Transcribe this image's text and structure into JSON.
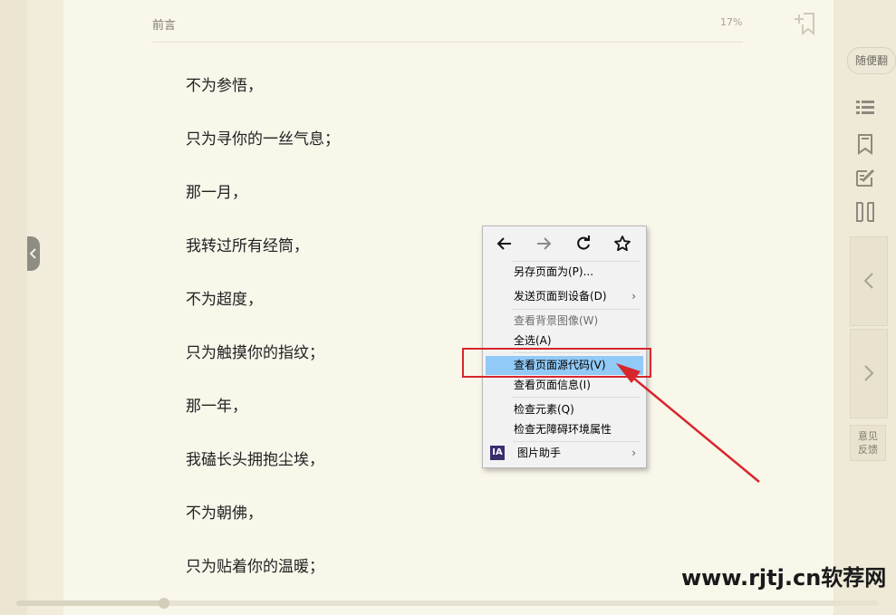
{
  "header": {
    "title": "前言",
    "progress": "17%"
  },
  "content": {
    "lines": [
      "不为参悟，",
      "只为寻你的一丝气息；",
      "那一月，",
      "我转过所有经筒，",
      "不为超度，",
      "只为触摸你的指纹；",
      "那一年，",
      "我磕长头拥抱尘埃，",
      "不为朝佛，",
      "只为贴着你的温暖；"
    ]
  },
  "sidebar": {
    "random_label": "随便翻",
    "feedback_line1": "意见",
    "feedback_line2": "反馈"
  },
  "context_menu": {
    "items": {
      "save_page": "另存页面为(P)...",
      "send_page": "发送页面到设备(D)",
      "view_bg_image": "查看背景图像(W)",
      "select_all": "全选(A)",
      "view_source": "查看页面源代码(V)",
      "view_info": "查看页面信息(I)",
      "inspect": "检查元素(Q)",
      "inspect_a11y": "检查无障碍环境属性",
      "image_helper": "图片助手"
    },
    "image_helper_badge": "IA"
  },
  "watermark": "www.rjtj.cn软荐网",
  "colors": {
    "highlight": "#91c9f7",
    "annotation_red": "#d7262c",
    "page_bg": "#f9f6ea"
  }
}
